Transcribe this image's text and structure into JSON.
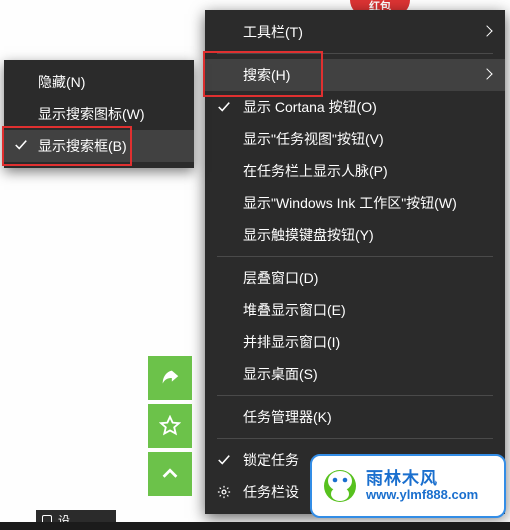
{
  "decor": {
    "ribbon": "红包",
    "settings_chip": "设"
  },
  "menu": {
    "toolbars": "工具栏(T)",
    "search": "搜索(H)",
    "cortana": "显示 Cortana 按钮(O)",
    "taskview": "显示\"任务视图\"按钮(V)",
    "people": "在任务栏上显示人脉(P)",
    "ink": "显示\"Windows Ink 工作区\"按钮(W)",
    "touchkb": "显示触摸键盘按钮(Y)",
    "cascade": "层叠窗口(D)",
    "stacked": "堆叠显示窗口(E)",
    "sidebyside": "并排显示窗口(I)",
    "desktop": "显示桌面(S)",
    "taskmgr": "任务管理器(K)",
    "lock": "锁定任务",
    "settings": "任务栏设"
  },
  "submenu": {
    "hidden": "隐藏(N)",
    "icon": "显示搜索图标(W)",
    "box": "显示搜索框(B)"
  },
  "watermark": {
    "title": "雨林木风",
    "url": "www.ylmf888.com"
  }
}
